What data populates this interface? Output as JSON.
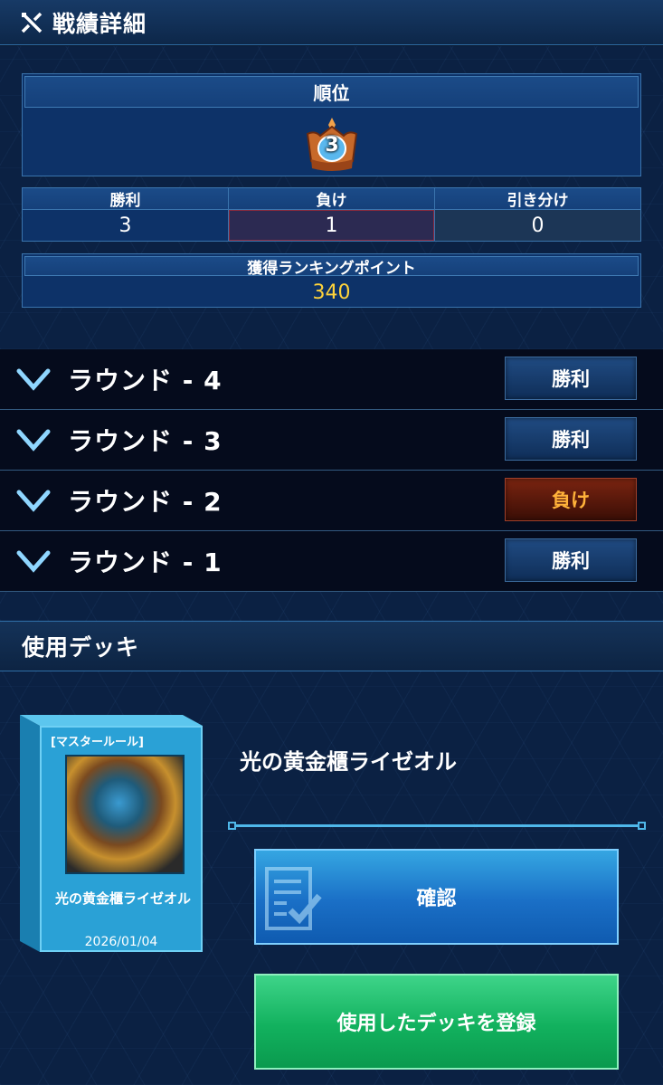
{
  "header": {
    "title": "戦績詳細",
    "icon": "crossed-swords-icon"
  },
  "rank": {
    "label": "順位",
    "value": "3",
    "icon": "crown-icon"
  },
  "stats": {
    "win_label": "勝利",
    "win_value": "3",
    "lose_label": "負け",
    "lose_value": "1",
    "draw_label": "引き分け",
    "draw_value": "0"
  },
  "points": {
    "label": "獲得ランキングポイント",
    "value": "340"
  },
  "rounds": [
    {
      "label": "ラウンド - 4",
      "result": "勝利"
    },
    {
      "label": "ラウンド - 3",
      "result": "勝利"
    },
    {
      "label": "ラウンド - 2",
      "result": "負け"
    },
    {
      "label": "ラウンド - 1",
      "result": "勝利"
    }
  ],
  "deck_section": {
    "title": "使用デッキ",
    "rule": "[マスタールール]",
    "box_name": "光の黄金櫃ライゼオル",
    "date": "2026/01/04",
    "deck_title": "光の黄金櫃ライゼオル",
    "confirm_label": "確認",
    "register_label": "使用したデッキを登録"
  },
  "colors": {
    "win": "#0f2e58",
    "lose": "#7a2410",
    "points": "#ffd33a",
    "confirm": "#1a6fc6",
    "register": "#12b15e"
  }
}
